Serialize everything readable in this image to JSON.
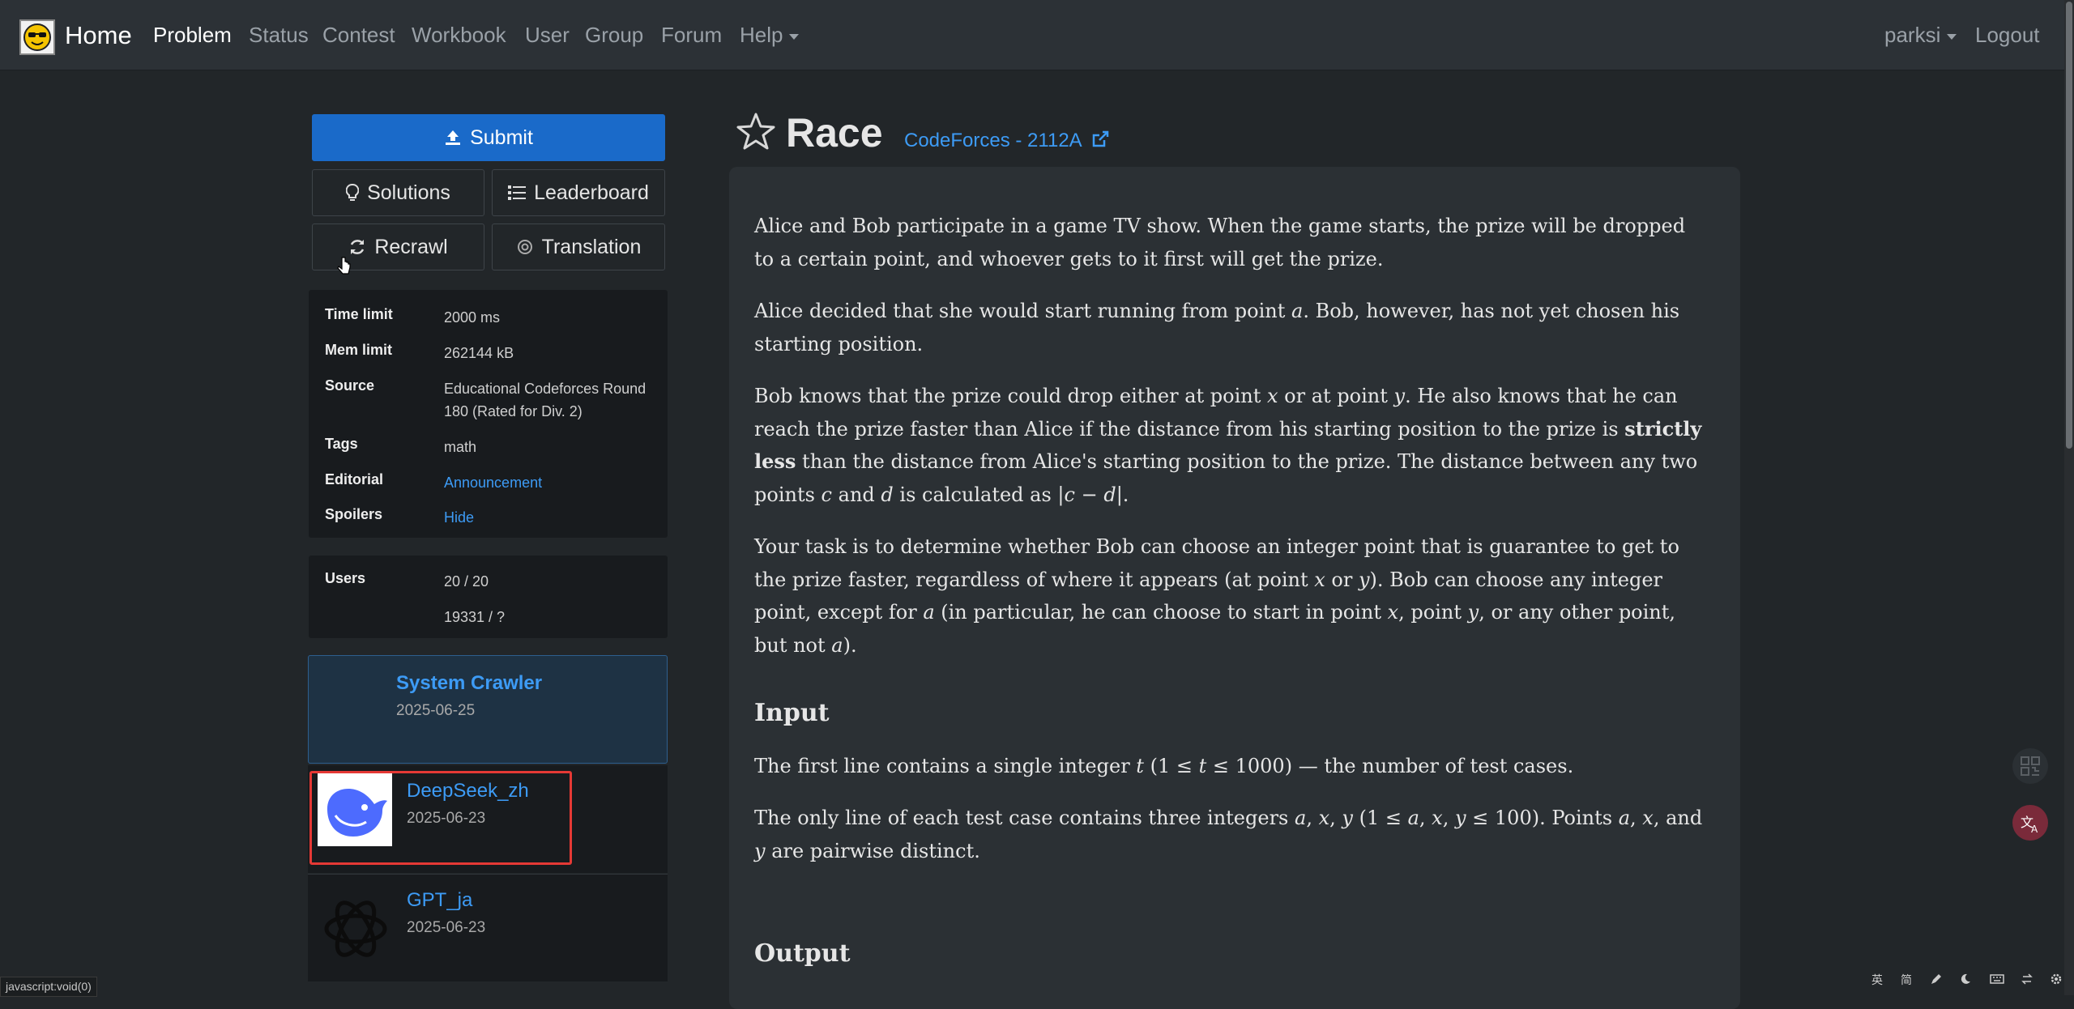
{
  "nav": {
    "brand": "Home",
    "items": [
      "Problem",
      "Status",
      "Contest",
      "Workbook",
      "User",
      "Group",
      "Forum",
      "Help"
    ],
    "user": "parksi",
    "logout": "Logout"
  },
  "sidebar": {
    "submit": "Submit",
    "solutions": "Solutions",
    "leaderboard": "Leaderboard",
    "recrawl": "Recrawl",
    "translation": "Translation",
    "info": {
      "time_limit_label": "Time limit",
      "time_limit": "2000 ms",
      "mem_limit_label": "Mem limit",
      "mem_limit": "262144 kB",
      "source_label": "Source",
      "source": "Educational Codeforces Round 180 (Rated for Div. 2)",
      "tags_label": "Tags",
      "tags": "math",
      "editorial_label": "Editorial",
      "editorial": "Announcement",
      "spoilers_label": "Spoilers",
      "spoilers": "Hide"
    },
    "users": {
      "label": "Users",
      "line1": "20 / 20",
      "line2": "19331 / ?"
    },
    "solutions_list": [
      {
        "name": "System Crawler",
        "date": "2025-06-25"
      },
      {
        "name": "DeepSeek_zh",
        "date": "2025-06-23"
      },
      {
        "name": "GPT_ja",
        "date": "2025-06-23"
      }
    ]
  },
  "problem": {
    "title": "Race",
    "source_link": "CodeForces - 2112A",
    "input_heading": "Input",
    "output_heading": "Output"
  },
  "statusbar": "javascript:void(0)",
  "tray": [
    "英",
    "简"
  ],
  "colors": {
    "primary": "#1a6ac9",
    "link": "#3d9bf5",
    "highlight": "#e53935"
  }
}
